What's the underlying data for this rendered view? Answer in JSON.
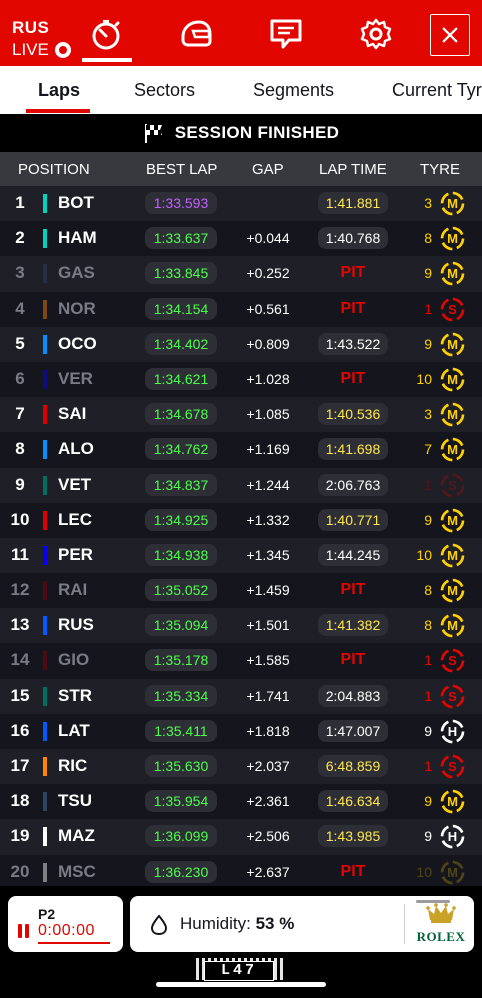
{
  "topbar": {
    "live_driver": "RUS",
    "live_label": "LIVE",
    "icons": [
      "stopwatch-icon",
      "helmet-icon",
      "radio-message-icon",
      "settings-gear-icon",
      "close-icon"
    ]
  },
  "tabs": [
    "Laps",
    "Sectors",
    "Segments",
    "Current Tyre"
  ],
  "session_status": "SESSION FINISHED",
  "table": {
    "headers": [
      "POSITION",
      "BEST LAP",
      "GAP",
      "LAP TIME",
      "TYRE"
    ],
    "rows": [
      {
        "pos": "1",
        "driver": "BOT",
        "team_color": "#00d2be",
        "best_lap": "1:33.593",
        "best_color": "#c060ff",
        "gap": "",
        "lap_time": "1:41.881",
        "lap_color": "#ffe84d",
        "tyre_laps": "3",
        "tyre": "M",
        "dim": false
      },
      {
        "pos": "2",
        "driver": "HAM",
        "team_color": "#00d2be",
        "best_lap": "1:33.637",
        "best_color": "#4cff4c",
        "gap": "+0.044",
        "lap_time": "1:40.768",
        "lap_color": "#ffffff",
        "tyre_laps": "8",
        "tyre": "M",
        "dim": false
      },
      {
        "pos": "3",
        "driver": "GAS",
        "team_color": "#2b4562",
        "best_lap": "1:33.845",
        "best_color": "#4cff4c",
        "gap": "+0.252",
        "lap_time": "PIT",
        "lap_color": "#e10600",
        "tyre_laps": "9",
        "tyre": "M",
        "dim": true
      },
      {
        "pos": "4",
        "driver": "NOR",
        "team_color": "#ff8700",
        "best_lap": "1:34.154",
        "best_color": "#4cff4c",
        "gap": "+0.561",
        "lap_time": "PIT",
        "lap_color": "#e10600",
        "tyre_laps": "1",
        "tyre": "S",
        "dim": true
      },
      {
        "pos": "5",
        "driver": "OCO",
        "team_color": "#0090ff",
        "best_lap": "1:34.402",
        "best_color": "#4cff4c",
        "gap": "+0.809",
        "lap_time": "1:43.522",
        "lap_color": "#ffffff",
        "tyre_laps": "9",
        "tyre": "M",
        "dim": false
      },
      {
        "pos": "6",
        "driver": "VER",
        "team_color": "#0600ef",
        "best_lap": "1:34.621",
        "best_color": "#4cff4c",
        "gap": "+1.028",
        "lap_time": "PIT",
        "lap_color": "#e10600",
        "tyre_laps": "10",
        "tyre": "M",
        "dim": true
      },
      {
        "pos": "7",
        "driver": "SAI",
        "team_color": "#dc0000",
        "best_lap": "1:34.678",
        "best_color": "#4cff4c",
        "gap": "+1.085",
        "lap_time": "1:40.536",
        "lap_color": "#ffe84d",
        "tyre_laps": "3",
        "tyre": "M",
        "dim": false
      },
      {
        "pos": "8",
        "driver": "ALO",
        "team_color": "#0090ff",
        "best_lap": "1:34.762",
        "best_color": "#4cff4c",
        "gap": "+1.169",
        "lap_time": "1:41.698",
        "lap_color": "#ffe84d",
        "tyre_laps": "7",
        "tyre": "M",
        "dim": false
      },
      {
        "pos": "9",
        "driver": "VET",
        "team_color": "#006f62",
        "best_lap": "1:34.837",
        "best_color": "#4cff4c",
        "gap": "+1.244",
        "lap_time": "2:06.763",
        "lap_color": "#ffffff",
        "tyre_laps": "1",
        "tyre": "S",
        "dim": false,
        "tyre_dim": true
      },
      {
        "pos": "10",
        "driver": "LEC",
        "team_color": "#dc0000",
        "best_lap": "1:34.925",
        "best_color": "#4cff4c",
        "gap": "+1.332",
        "lap_time": "1:40.771",
        "lap_color": "#ffe84d",
        "tyre_laps": "9",
        "tyre": "M",
        "dim": false
      },
      {
        "pos": "11",
        "driver": "PER",
        "team_color": "#0600ef",
        "best_lap": "1:34.938",
        "best_color": "#4cff4c",
        "gap": "+1.345",
        "lap_time": "1:44.245",
        "lap_color": "#ffffff",
        "tyre_laps": "10",
        "tyre": "M",
        "dim": false
      },
      {
        "pos": "12",
        "driver": "RAI",
        "team_color": "#900000",
        "best_lap": "1:35.052",
        "best_color": "#4cff4c",
        "gap": "+1.459",
        "lap_time": "PIT",
        "lap_color": "#e10600",
        "tyre_laps": "8",
        "tyre": "M",
        "dim": true
      },
      {
        "pos": "13",
        "driver": "RUS",
        "team_color": "#005aff",
        "best_lap": "1:35.094",
        "best_color": "#4cff4c",
        "gap": "+1.501",
        "lap_time": "1:41.382",
        "lap_color": "#ffe84d",
        "tyre_laps": "8",
        "tyre": "M",
        "dim": false
      },
      {
        "pos": "14",
        "driver": "GIO",
        "team_color": "#900000",
        "best_lap": "1:35.178",
        "best_color": "#4cff4c",
        "gap": "+1.585",
        "lap_time": "PIT",
        "lap_color": "#e10600",
        "tyre_laps": "1",
        "tyre": "S",
        "dim": true
      },
      {
        "pos": "15",
        "driver": "STR",
        "team_color": "#006f62",
        "best_lap": "1:35.334",
        "best_color": "#4cff4c",
        "gap": "+1.741",
        "lap_time": "2:04.883",
        "lap_color": "#ffffff",
        "tyre_laps": "1",
        "tyre": "S",
        "dim": false
      },
      {
        "pos": "16",
        "driver": "LAT",
        "team_color": "#005aff",
        "best_lap": "1:35.411",
        "best_color": "#4cff4c",
        "gap": "+1.818",
        "lap_time": "1:47.007",
        "lap_color": "#ffffff",
        "tyre_laps": "9",
        "tyre": "H",
        "dim": false
      },
      {
        "pos": "17",
        "driver": "RIC",
        "team_color": "#ff8700",
        "best_lap": "1:35.630",
        "best_color": "#4cff4c",
        "gap": "+2.037",
        "lap_time": "6:48.859",
        "lap_color": "#ffe84d",
        "tyre_laps": "1",
        "tyre": "S",
        "dim": false
      },
      {
        "pos": "18",
        "driver": "TSU",
        "team_color": "#2b4562",
        "best_lap": "1:35.954",
        "best_color": "#4cff4c",
        "gap": "+2.361",
        "lap_time": "1:46.634",
        "lap_color": "#ffe84d",
        "tyre_laps": "9",
        "tyre": "M",
        "dim": false
      },
      {
        "pos": "19",
        "driver": "MAZ",
        "team_color": "#ffffff",
        "best_lap": "1:36.099",
        "best_color": "#4cff4c",
        "gap": "+2.506",
        "lap_time": "1:43.985",
        "lap_color": "#ffe84d",
        "tyre_laps": "9",
        "tyre": "H",
        "dim": false
      },
      {
        "pos": "20",
        "driver": "MSC",
        "team_color": "#ffffff",
        "best_lap": "1:36.230",
        "best_color": "#4cff4c",
        "gap": "+2.637",
        "lap_time": "PIT",
        "lap_color": "#e10600",
        "tyre_laps": "10",
        "tyre": "M",
        "dim": true,
        "tyre_dim": true
      }
    ]
  },
  "tyre_colors": {
    "M": "#ffd100",
    "S": "#e10600",
    "H": "#ffffff"
  },
  "bottom": {
    "timer_label": "P2",
    "timer_value": "0:00:00",
    "humidity_label": "Humidity:",
    "humidity_value": "53 %",
    "sponsor": "ROLEX"
  },
  "lap_marker": "L47",
  "colors": {
    "brand_red": "#e10600",
    "background": "#15151e"
  }
}
